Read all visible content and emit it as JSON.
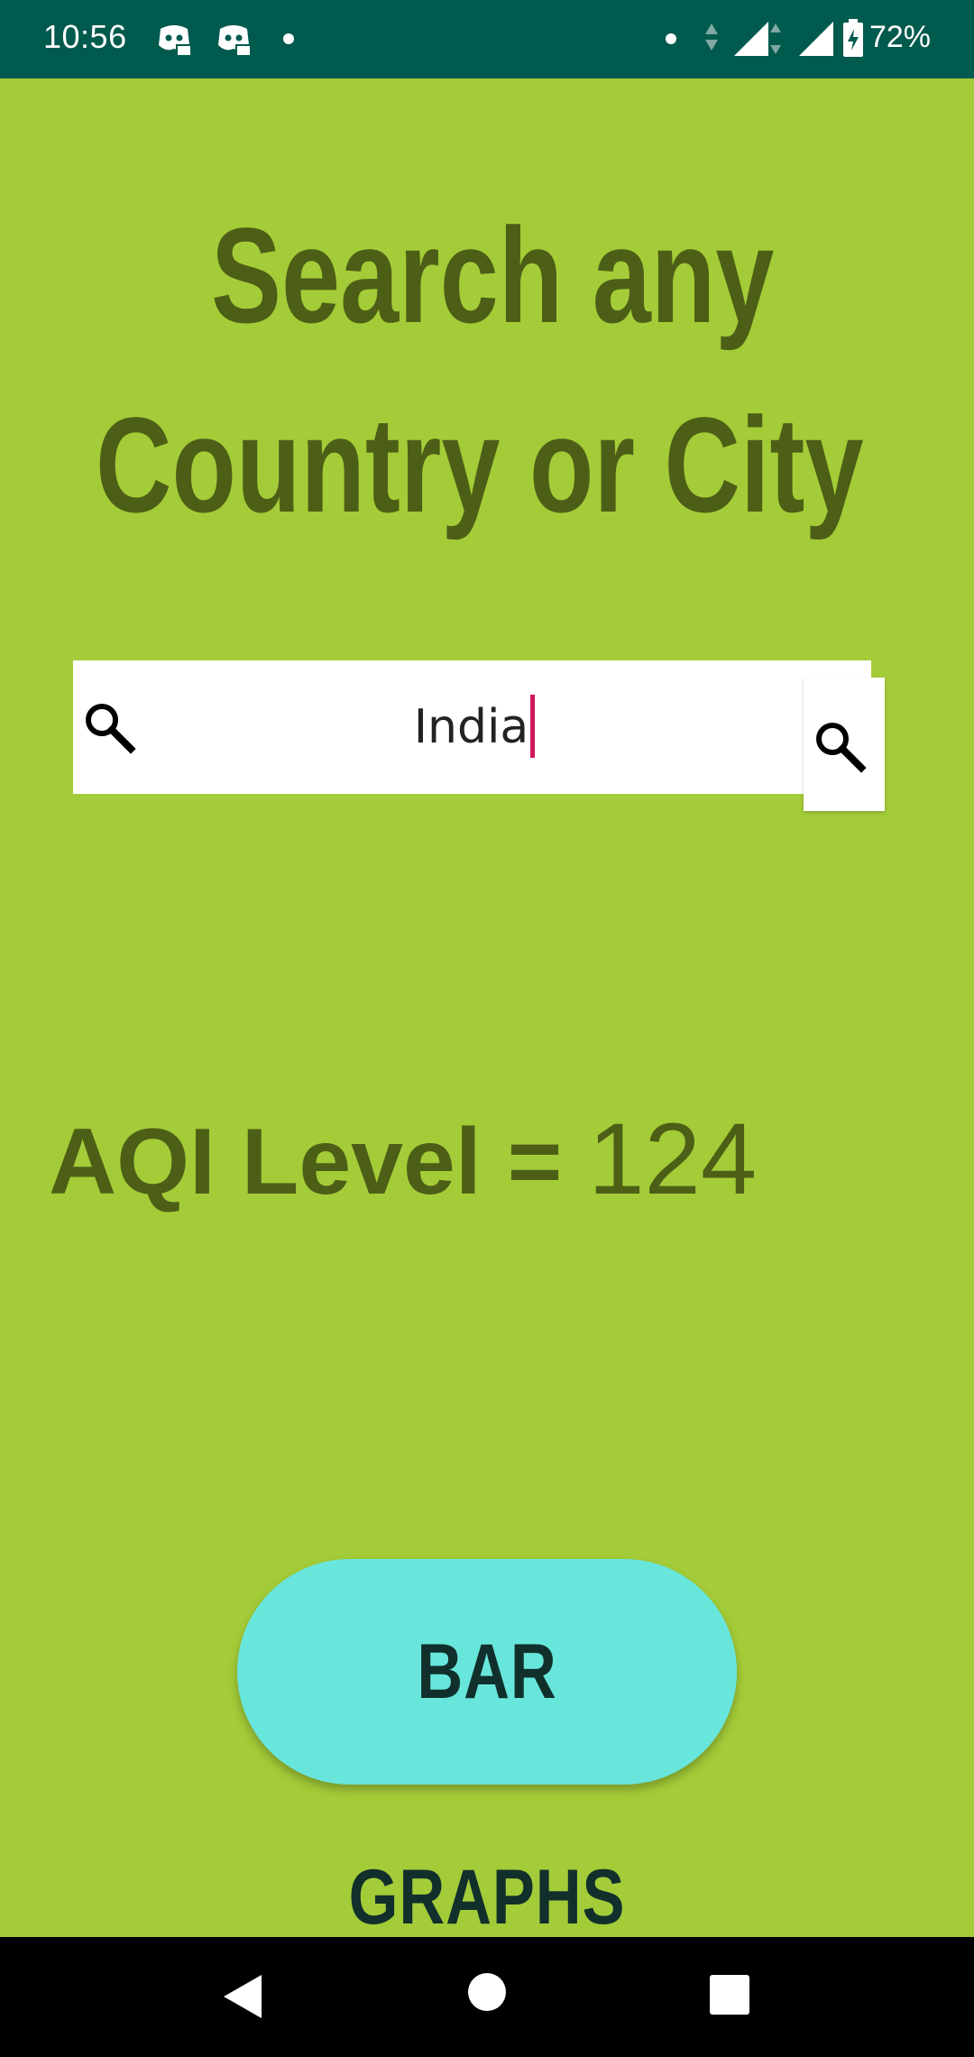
{
  "status_bar": {
    "time": "10:56",
    "battery_percent": "72%",
    "background": "#005a4e",
    "icons": [
      "discord-icon",
      "discord-icon",
      "notification-dot-icon",
      "dot-icon",
      "data-arrows-icon",
      "signal-x-icon",
      "signal-x-icon",
      "battery-charging-icon"
    ]
  },
  "headline": {
    "line1": "Search any",
    "line2": "Country or City",
    "color": "#4d5f16"
  },
  "search": {
    "value": "India",
    "left_icon": "search-icon",
    "button_icon": "search-icon",
    "caret_color": "#d0185c"
  },
  "aqi": {
    "label": "AQI Level = ",
    "value": "124"
  },
  "bar_graphs_button": {
    "label": "BAR GRAPHS",
    "background": "#68e6dc"
  },
  "nav_bar": {
    "buttons": [
      "back-icon",
      "home-icon",
      "recents-icon"
    ]
  },
  "theme": {
    "background": "#a4cc38"
  }
}
